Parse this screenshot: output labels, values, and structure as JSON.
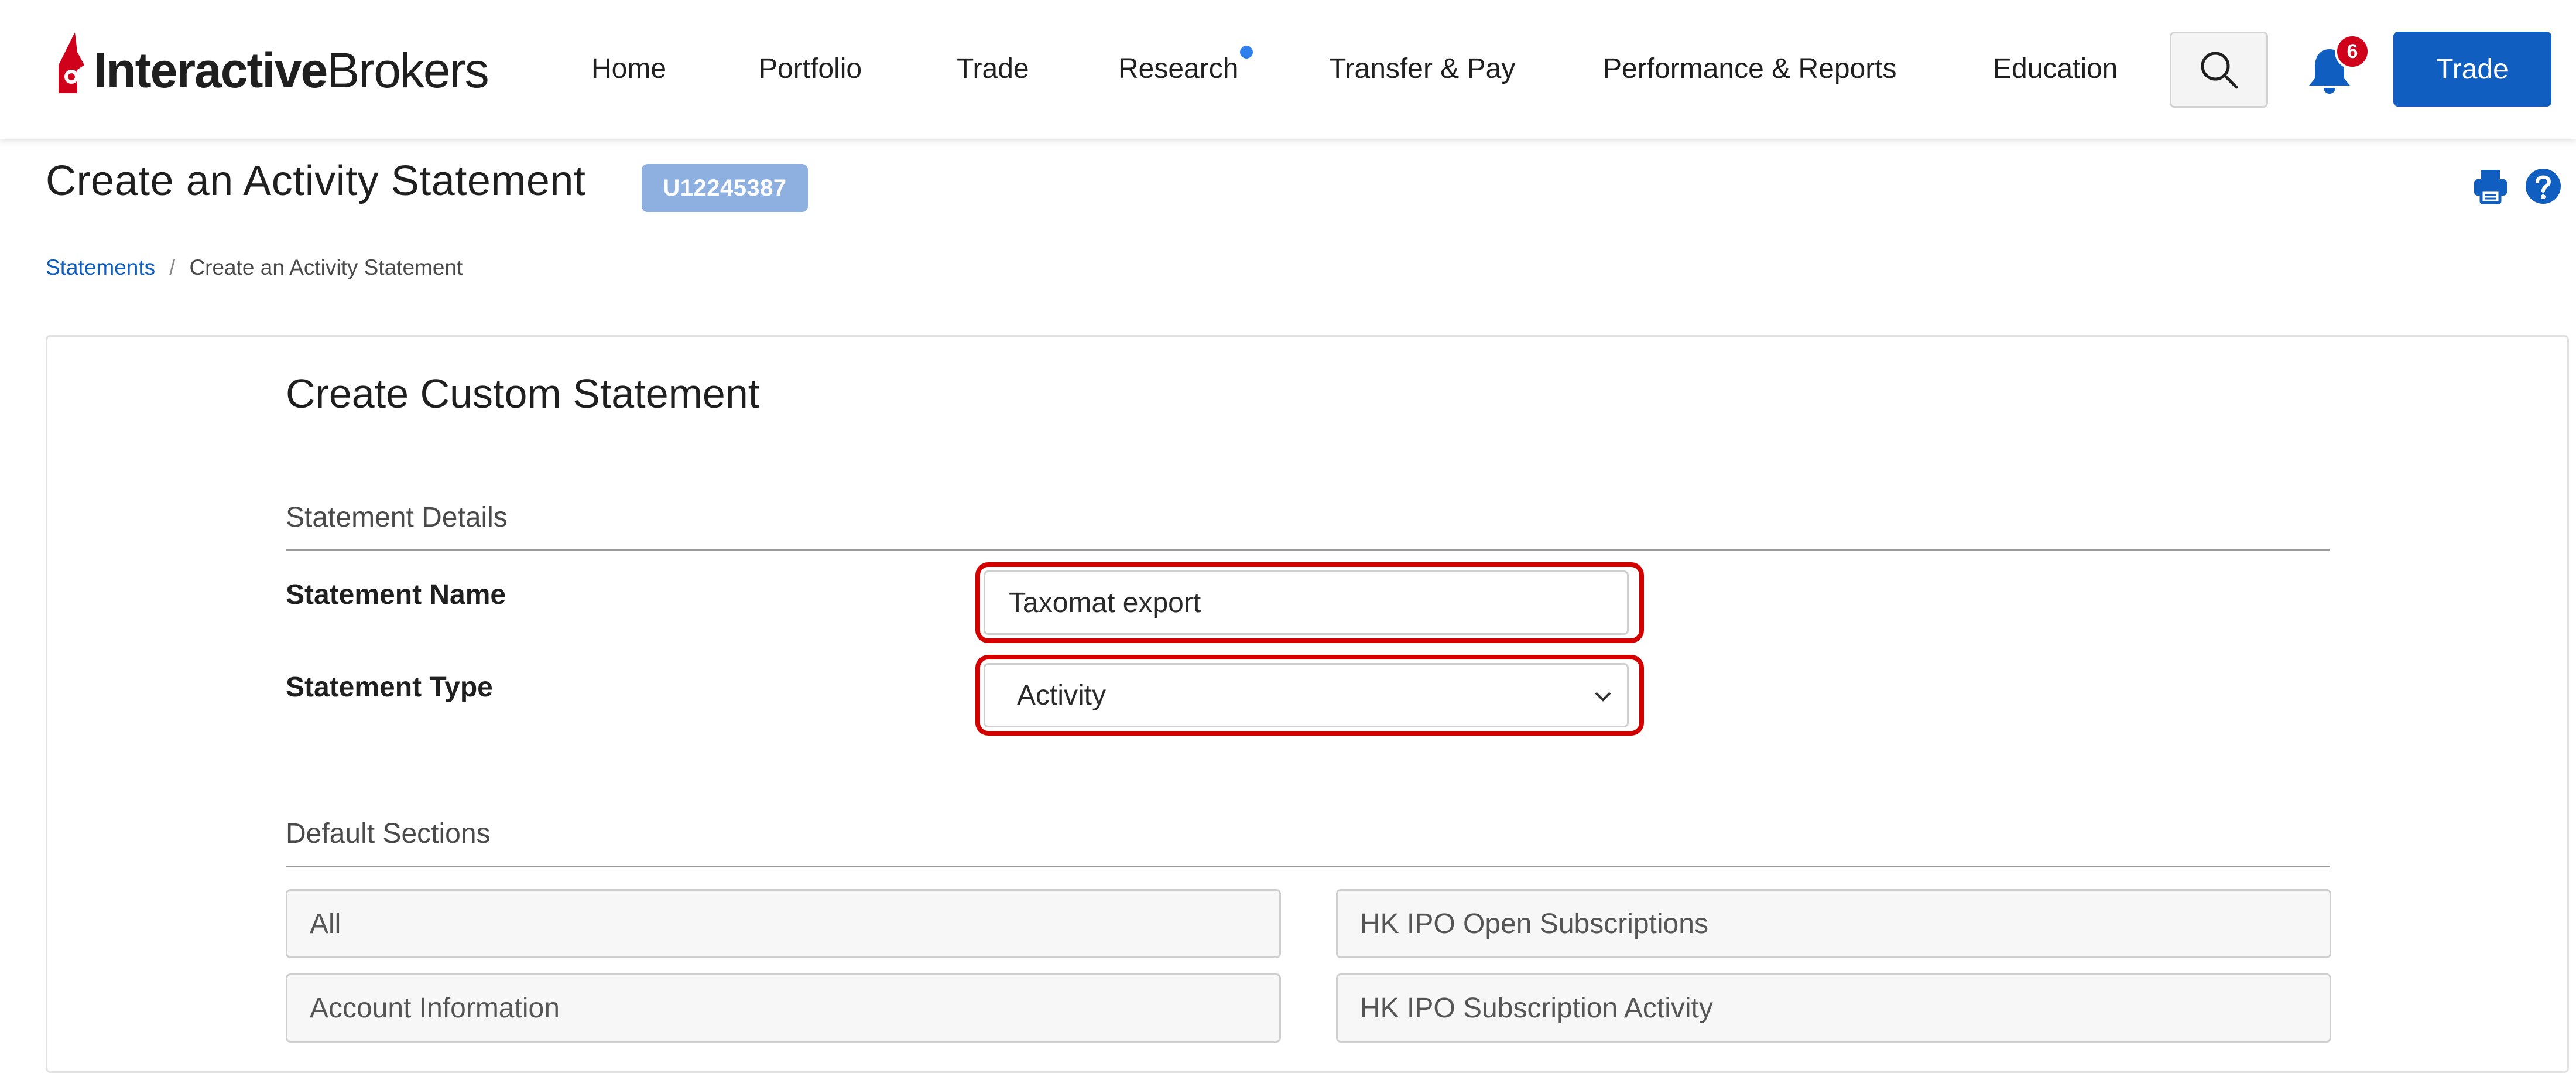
{
  "brand": {
    "logo_bold": "Interactive",
    "logo_light": "Brokers",
    "accent_color": "#d0021b",
    "primary_blue": "#0f5ec0"
  },
  "nav": {
    "items": [
      {
        "label": "Home"
      },
      {
        "label": "Portfolio"
      },
      {
        "label": "Trade"
      },
      {
        "label": "Research"
      },
      {
        "label": "Transfer & Pay"
      },
      {
        "label": "Performance & Reports"
      },
      {
        "label": "Education"
      }
    ],
    "search_icon": "search-icon",
    "bell_icon": "bell-icon",
    "notification_count": "6",
    "trade_button": "Trade"
  },
  "header": {
    "title": "Create an Activity Statement",
    "account_id": "U12245387",
    "print_icon": "print-icon",
    "help_icon": "help-icon"
  },
  "breadcrumb": {
    "root": "Statements",
    "separator": "/",
    "current": "Create an Activity Statement"
  },
  "form": {
    "title": "Create Custom Statement",
    "details_heading": "Statement Details",
    "name_label": "Statement Name",
    "name_value": "Taxomat export",
    "type_label": "Statement Type",
    "type_value": "Activity",
    "default_sections_heading": "Default Sections",
    "sections_left": [
      "All",
      "Account Information"
    ],
    "sections_right": [
      "HK IPO Open Subscriptions",
      "HK IPO Subscription Activity"
    ],
    "highlight_color": "#d40000"
  }
}
